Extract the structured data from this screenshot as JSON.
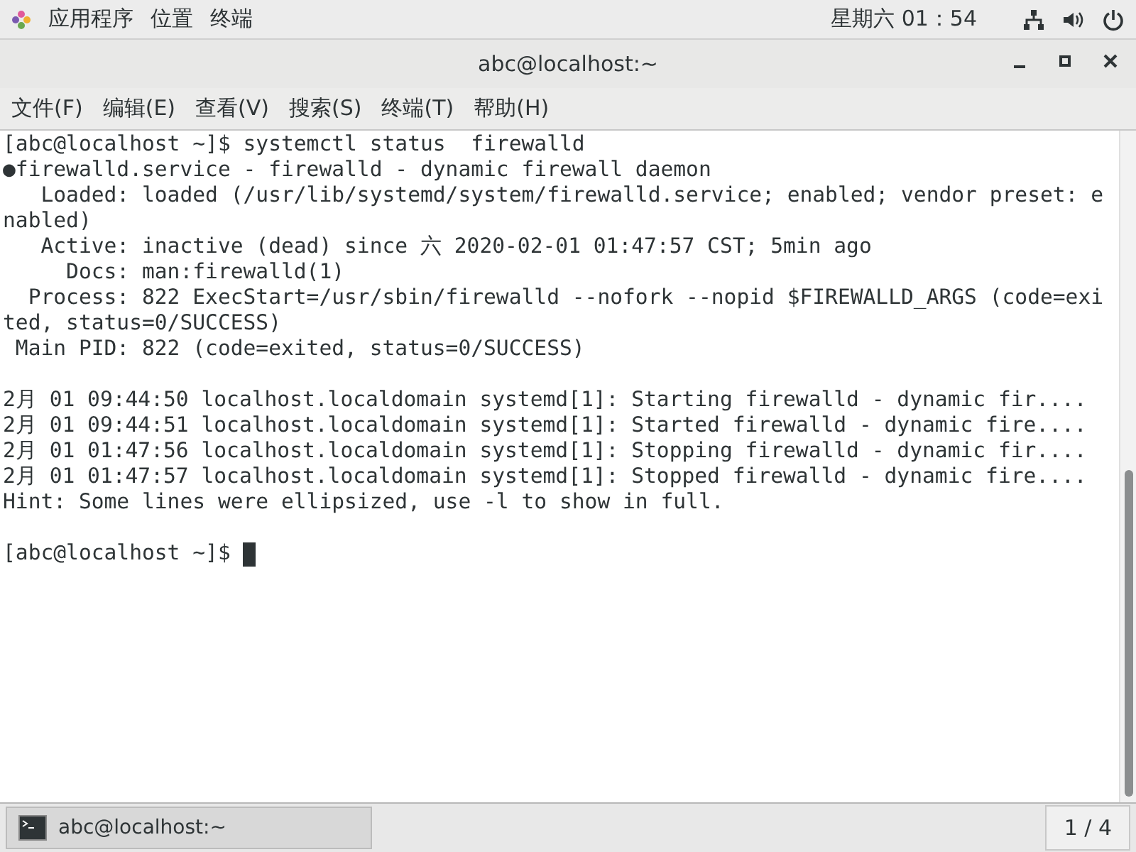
{
  "top_bar": {
    "menus": [
      "应用程序",
      "位置",
      "终端"
    ],
    "clock": "星期六 01：54"
  },
  "window": {
    "title": "abc@localhost:~"
  },
  "menu_bar": [
    "文件(F)",
    "编辑(E)",
    "查看(V)",
    "搜索(S)",
    "终端(T)",
    "帮助(H)"
  ],
  "terminal": {
    "blocks": [
      [
        "[abc@localhost ~]$ systemctl status  firewalld",
        "●firewalld.service - firewalld - dynamic firewall daemon",
        "   Loaded: loaded (/usr/lib/systemd/system/firewalld.service; enabled; vendor preset: e",
        "nabled)",
        "   Active: inactive (dead) since 六 2020-02-01 01:47:57 CST; 5min ago",
        "     Docs: man:firewalld(1)",
        "  Process: 822 ExecStart=/usr/sbin/firewalld --nofork --nopid $FIREWALLD_ARGS (code=exi",
        "ted, status=0/SUCCESS)",
        " Main PID: 822 (code=exited, status=0/SUCCESS)"
      ],
      [
        "2月 01 09:44:50 localhost.localdomain systemd[1]: Starting firewalld - dynamic fir....",
        "2月 01 09:44:51 localhost.localdomain systemd[1]: Started firewalld - dynamic fire....",
        "2月 01 01:47:56 localhost.localdomain systemd[1]: Stopping firewalld - dynamic fir....",
        "2月 01 01:47:57 localhost.localdomain systemd[1]: Stopped firewalld - dynamic fire....",
        "Hint: Some lines were ellipsized, use -l to show in full."
      ]
    ],
    "prompt": "[abc@localhost ~]$ "
  },
  "taskbar": {
    "task": "abc@localhost:~",
    "workspace": "1 / 4"
  }
}
